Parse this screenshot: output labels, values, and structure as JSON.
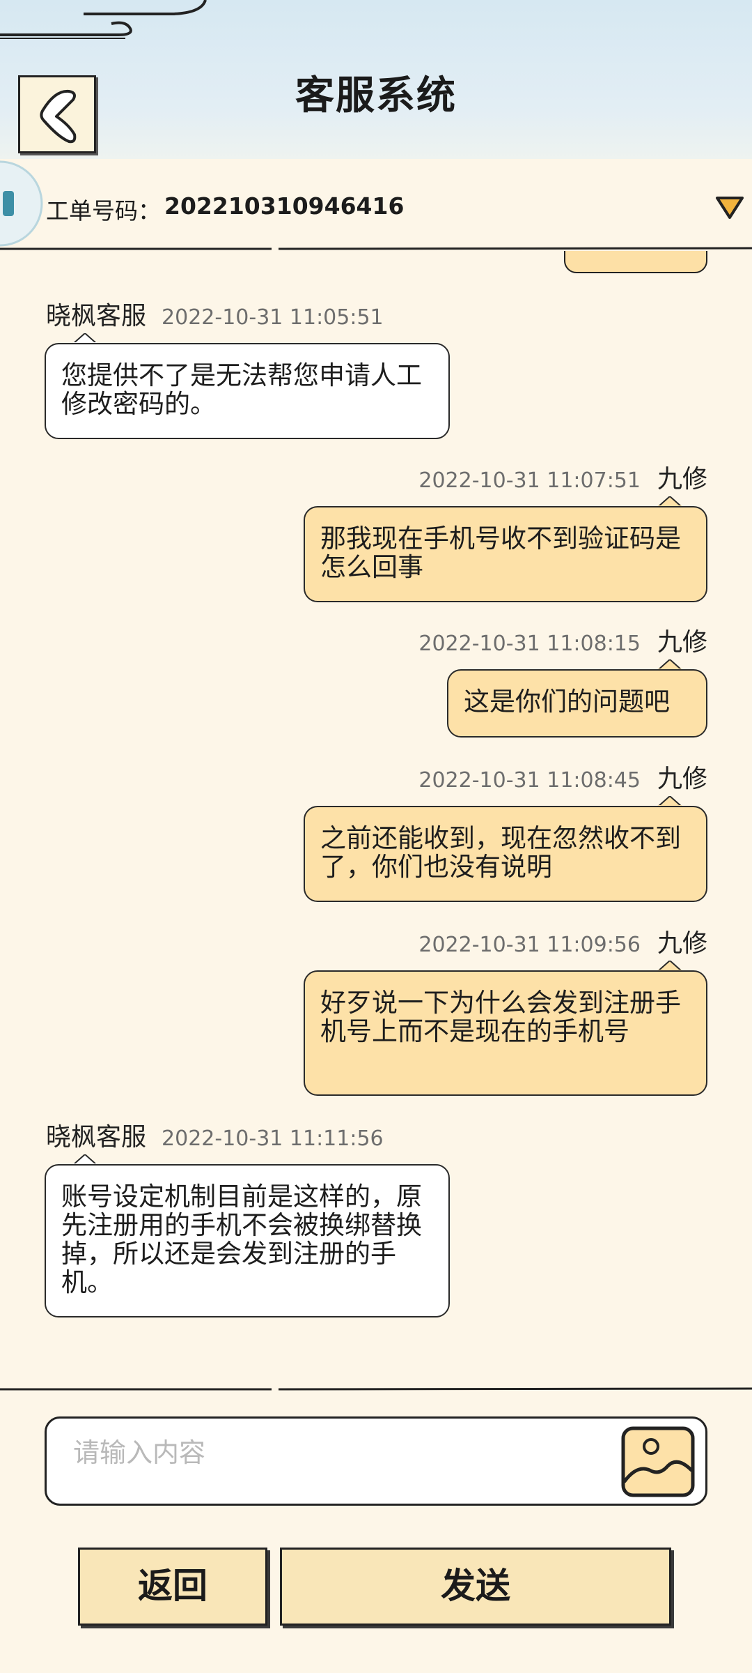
{
  "header": {
    "title": "客服系统"
  },
  "ticket": {
    "label": "工单号码：",
    "number": "20221031094641​6"
  },
  "messages": [
    {
      "sender": "晓枫客服",
      "side": "agent",
      "time": "2022-10-31 11:05:51",
      "text": "您提供不了是无法帮您申请人工修改密码的。"
    },
    {
      "sender": "九修",
      "side": "me",
      "time": "2022-10-31 11:07:51",
      "text": "那我现在手机号收不到验证码是怎么回事"
    },
    {
      "sender": "九修",
      "side": "me",
      "time": "2022-10-31 11:08:15",
      "text": "这是你们的问题吧"
    },
    {
      "sender": "九修",
      "side": "me",
      "time": "2022-10-31 11:08:45",
      "text": "之前还能收到，现在忽然收不到了，你们也没有说明"
    },
    {
      "sender": "九修",
      "side": "me",
      "time": "2022-10-31 11:09:56",
      "text": "好歹说一下为什么会发到注册手机号上而不是现在的手机号"
    },
    {
      "sender": "晓枫客服",
      "side": "agent",
      "time": "2022-10-31 11:11:56",
      "text": "账号设定机制目前是这样的，原先注册用的手机不会被换绑替换掉，所以还是会发到注册的手机。"
    }
  ],
  "input": {
    "placeholder": "请输入内容",
    "value": ""
  },
  "buttons": {
    "back": "返回",
    "send": "发送"
  },
  "colors": {
    "my_bubble": "#fde1a8",
    "agent_bubble": "#ffffff",
    "header": "#d6e8f2",
    "background": "#fdf6e8",
    "dropdown": "#f2b33d"
  },
  "icons": {
    "back": "chevron-left-icon",
    "dropdown": "triangle-down-icon",
    "image": "image-icon",
    "logo": "app-logo-icon"
  }
}
